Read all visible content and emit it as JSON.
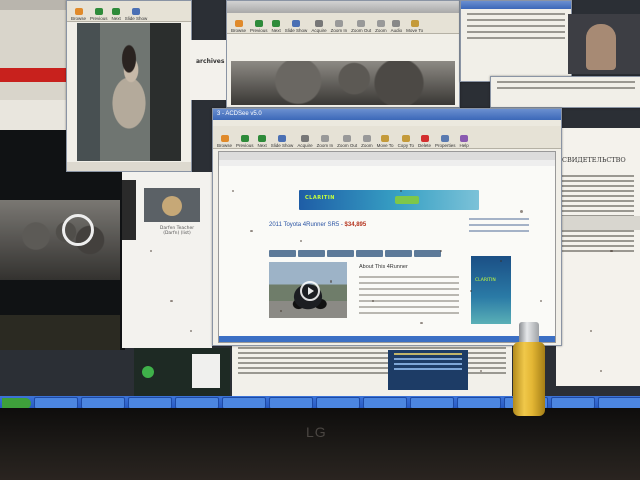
{
  "main_window": {
    "title": "3 - ACDSee v5.0",
    "toolbar": [
      "Browse",
      "Previous",
      "Next",
      "Slide Show",
      "Acquire",
      "Zoom In",
      "Zoom Out",
      "Zoom",
      "Move To",
      "Copy To",
      "Delete",
      "Properties",
      "Help"
    ],
    "web_page": {
      "title": "2011 Toyota 4Runner SR5",
      "price": "$34,895",
      "about_heading": "About This 4Runner",
      "banner_brand": "CLARITIN"
    }
  },
  "top_window": {
    "toolbar": [
      "Browse",
      "Previous",
      "Next",
      "Slide Show",
      "Acquire",
      "Zoom In",
      "Zoom Out",
      "Zoom",
      "Audio",
      "Move To"
    ]
  },
  "left_window": {
    "toolbar": [
      "Browse",
      "Previous",
      "Next",
      "Slide Show"
    ]
  },
  "background_labels": {
    "archives": "archives",
    "profile_name": "Darfen Teacher (Darfn) (list)",
    "russian_heading": "СВИДЕТЕЛЬСТВО"
  },
  "bezel_logo": "LG",
  "colors": {
    "titlebar": "#3c68b8",
    "taskbar": "#2456c0",
    "lighter": "#e3b634"
  }
}
